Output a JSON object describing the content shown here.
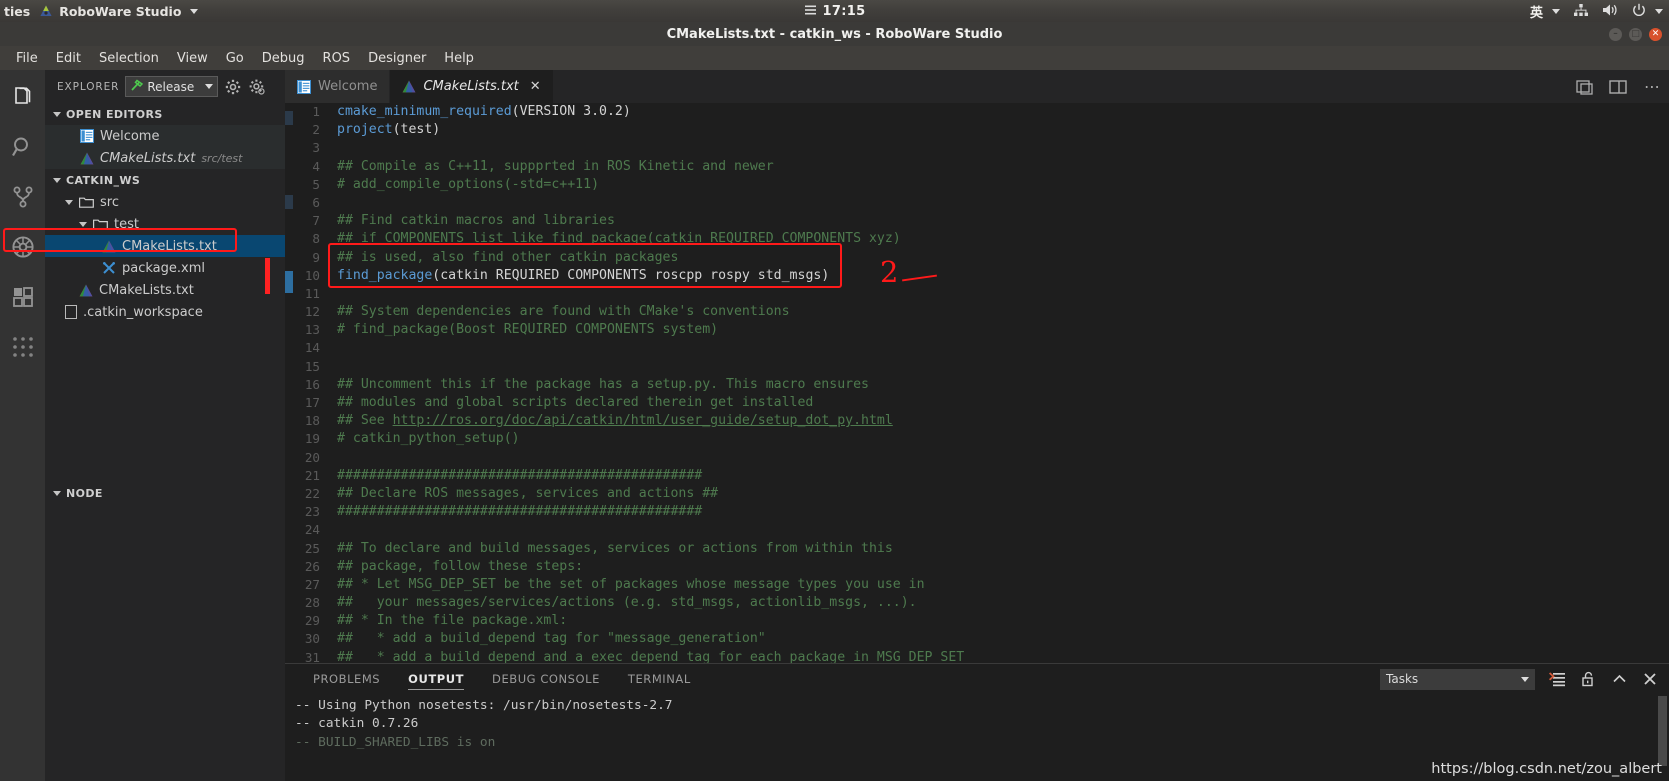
{
  "system_bar": {
    "left_truncated_label": "ties",
    "app_indicator": "RoboWare Studio",
    "app_indicator_icon": "roboware-logo-icon",
    "clock_icon": "menu-lines-icon",
    "clock": "17:15",
    "ime": "英",
    "ime_caret_icon": "chevron-down-icon",
    "network_icon": "network-icon",
    "volume_icon": "volume-icon",
    "power_icon": "power-icon",
    "power_caret_icon": "chevron-down-icon"
  },
  "title_bar": {
    "title": "CMakeLists.txt - catkin_ws - RoboWare Studio",
    "minimize_label": "",
    "maximize_label": "",
    "close_label": "✕"
  },
  "menu_bar": {
    "items": [
      "File",
      "Edit",
      "Selection",
      "View",
      "Go",
      "Debug",
      "ROS",
      "Designer",
      "Help"
    ]
  },
  "activity_bar": {
    "items": [
      {
        "name": "explorer-icon",
        "label": "Explorer"
      },
      {
        "name": "search-icon",
        "label": "Search"
      },
      {
        "name": "source-control-icon",
        "label": "Source Control"
      },
      {
        "name": "debug-icon",
        "label": "Debug"
      },
      {
        "name": "extensions-icon",
        "label": "Extensions"
      },
      {
        "name": "grid-apps-icon",
        "label": "Apps"
      }
    ]
  },
  "sidebar": {
    "header_title": "EXPLORER",
    "build_config": {
      "icon": "hammer-icon",
      "value": "Release",
      "caret_icon": "chevron-down-icon"
    },
    "header_actions": [
      {
        "name": "settings-gear-icon"
      },
      {
        "name": "settings-gear-alt-icon"
      }
    ],
    "open_editors": {
      "label": "OPEN EDITORS",
      "items": [
        {
          "name": "Welcome",
          "icon": "welcome-page-icon",
          "detail": "",
          "state": "hovered",
          "italic": false
        },
        {
          "name": "CMakeLists.txt",
          "icon": "cmake-icon",
          "detail": "src/test",
          "state": "active",
          "italic": true
        }
      ]
    },
    "workspace": {
      "label": "CATKIN_WS",
      "tree": [
        {
          "name": "src",
          "icon": "folder-open-icon",
          "depth": 1,
          "type": "folder"
        },
        {
          "name": "test",
          "icon": "folder-open-icon",
          "depth": 2,
          "type": "folder"
        },
        {
          "name": "CMakeLists.txt",
          "icon": "cmake-icon",
          "depth": 3,
          "type": "file",
          "state": "selected"
        },
        {
          "name": "package.xml",
          "icon": "xml-tools-icon",
          "depth": 3,
          "type": "file"
        },
        {
          "name": "CMakeLists.txt",
          "icon": "cmake-icon",
          "depth": 2,
          "type": "file"
        },
        {
          "name": ".catkin_workspace",
          "icon": "plain-file-icon",
          "depth": 1,
          "type": "file"
        }
      ]
    },
    "node_section_label": "NODE"
  },
  "editor": {
    "tabs": [
      {
        "label": "Welcome",
        "icon": "welcome-page-icon",
        "active": false,
        "italic": false,
        "closable": false
      },
      {
        "label": "CMakeLists.txt",
        "icon": "cmake-icon",
        "active": true,
        "italic": true,
        "closable": true,
        "close_label": "✕"
      }
    ],
    "tab_actions": [
      {
        "name": "split-editor-icon"
      },
      {
        "name": "toggle-layout-icon"
      },
      {
        "name": "more-actions-icon",
        "label": "⋯"
      }
    ],
    "annotation": "2",
    "lines": [
      {
        "n": 1,
        "tokens": [
          {
            "t": "cmake_minimum_required",
            "c": "fn"
          },
          {
            "t": "(VERSION 3.0.2)",
            "c": "plain"
          }
        ]
      },
      {
        "n": 2,
        "tokens": [
          {
            "t": "project",
            "c": "fn"
          },
          {
            "t": "(test)",
            "c": "plain"
          }
        ]
      },
      {
        "n": 3,
        "tokens": []
      },
      {
        "n": 4,
        "tokens": [
          {
            "t": "## Compile as C++11, suppprted in ROS Kinetic and newer",
            "c": "comment"
          }
        ]
      },
      {
        "n": 5,
        "tokens": [
          {
            "t": "# add_compile_options(-std=c++11)",
            "c": "comment"
          }
        ]
      },
      {
        "n": 6,
        "tokens": []
      },
      {
        "n": 7,
        "tokens": [
          {
            "t": "## Find catkin macros and libraries",
            "c": "comment"
          }
        ]
      },
      {
        "n": 8,
        "tokens": [
          {
            "t": "## if COMPONENTS list like find_package(catkin REQUIRED COMPONENTS xyz)",
            "c": "comment"
          }
        ]
      },
      {
        "n": 9,
        "tokens": [
          {
            "t": "## is used, also find other catkin packages",
            "c": "comment"
          }
        ]
      },
      {
        "n": 10,
        "tokens": [
          {
            "t": "find_package",
            "c": "fn"
          },
          {
            "t": "(catkin REQUIRED COMPONENTS roscpp rospy std_msgs)",
            "c": "plain"
          }
        ]
      },
      {
        "n": 11,
        "tokens": []
      },
      {
        "n": 12,
        "tokens": [
          {
            "t": "## System dependencies are found with CMake's conventions",
            "c": "comment"
          }
        ]
      },
      {
        "n": 13,
        "tokens": [
          {
            "t": "# find_package(Boost REQUIRED COMPONENTS system)",
            "c": "comment"
          }
        ]
      },
      {
        "n": 14,
        "tokens": []
      },
      {
        "n": 15,
        "tokens": []
      },
      {
        "n": 16,
        "tokens": [
          {
            "t": "## Uncomment this if the package has a setup.py. This macro ensures",
            "c": "comment"
          }
        ]
      },
      {
        "n": 17,
        "tokens": [
          {
            "t": "## modules and global scripts declared therein get installed",
            "c": "comment"
          }
        ]
      },
      {
        "n": 18,
        "tokens": [
          {
            "t": "## See ",
            "c": "comment"
          },
          {
            "t": "http://ros.org/doc/api/catkin/html/user_guide/setup_dot_py.html",
            "c": "link"
          }
        ]
      },
      {
        "n": 19,
        "tokens": [
          {
            "t": "# catkin_python_setup()",
            "c": "comment"
          }
        ]
      },
      {
        "n": 20,
        "tokens": []
      },
      {
        "n": 21,
        "tokens": [
          {
            "t": "##############################################",
            "c": "comment"
          }
        ]
      },
      {
        "n": 22,
        "tokens": [
          {
            "t": "## Declare ROS messages, services and actions ##",
            "c": "comment"
          }
        ]
      },
      {
        "n": 23,
        "tokens": [
          {
            "t": "##############################################",
            "c": "comment"
          }
        ]
      },
      {
        "n": 24,
        "tokens": []
      },
      {
        "n": 25,
        "tokens": [
          {
            "t": "## To declare and build messages, services or actions from within this",
            "c": "comment"
          }
        ]
      },
      {
        "n": 26,
        "tokens": [
          {
            "t": "## package, follow these steps:",
            "c": "comment"
          }
        ]
      },
      {
        "n": 27,
        "tokens": [
          {
            "t": "## * Let MSG_DEP_SET be the set of packages whose message types you use in",
            "c": "comment"
          }
        ]
      },
      {
        "n": 28,
        "tokens": [
          {
            "t": "##   your messages/services/actions (e.g. std_msgs, actionlib_msgs, ...).",
            "c": "comment"
          }
        ]
      },
      {
        "n": 29,
        "tokens": [
          {
            "t": "## * In the file package.xml:",
            "c": "comment"
          }
        ]
      },
      {
        "n": 30,
        "tokens": [
          {
            "t": "##   * add a build_depend tag for \"message_generation\"",
            "c": "comment"
          }
        ]
      },
      {
        "n": 31,
        "tokens": [
          {
            "t": "##   * add a build_depend and a exec_depend tag for each package in MSG_DEP_SET",
            "c": "comment"
          }
        ]
      }
    ]
  },
  "panel": {
    "tabs": [
      {
        "label": "PROBLEMS",
        "active": false
      },
      {
        "label": "OUTPUT",
        "active": true
      },
      {
        "label": "DEBUG CONSOLE",
        "active": false
      },
      {
        "label": "TERMINAL",
        "active": false
      }
    ],
    "channel_select": {
      "value": "Tasks",
      "caret_icon": "chevron-down-icon"
    },
    "actions": [
      {
        "name": "clear-output-icon"
      },
      {
        "name": "lock-icon"
      },
      {
        "name": "maximize-panel-icon",
        "label": "︿"
      },
      {
        "name": "close-panel-icon",
        "label": "✕"
      }
    ],
    "output_lines": [
      {
        "text": "-- Using Python nosetests: /usr/bin/nosetests-2.7",
        "dim": false
      },
      {
        "text": "-- catkin 0.7.26",
        "dim": false
      },
      {
        "text": "-- BUILD_SHARED_LIBS is on",
        "dim": true
      }
    ]
  },
  "watermark": "https://blog.csdn.net/zou_albert",
  "colors": {
    "editor_bg": "#1e1e1e",
    "sidebar_bg": "#252526",
    "activitybar_bg": "#333333",
    "selection_blue": "#094771",
    "annotation_red": "#ff1a1a",
    "comment_green": "#4e7a4e",
    "function_blue": "#5b9bd5"
  }
}
